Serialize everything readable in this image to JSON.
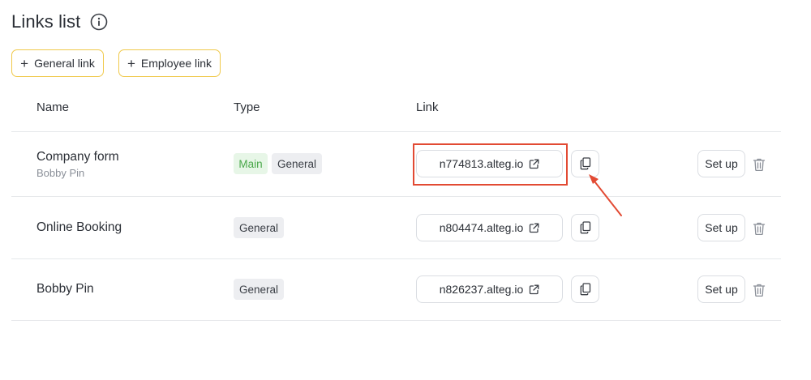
{
  "page": {
    "title": "Links list"
  },
  "actions": {
    "general_link": "General link",
    "employee_link": "Employee link"
  },
  "table": {
    "columns": [
      "Name",
      "Type",
      "Link"
    ],
    "rows": [
      {
        "name": "Company form",
        "subtitle": "Bobby Pin",
        "badges": [
          "Main",
          "General"
        ],
        "link": "n774813.alteg.io",
        "setup": "Set up"
      },
      {
        "name": "Online Booking",
        "subtitle": "",
        "badges": [
          "General"
        ],
        "link": "n804474.alteg.io",
        "setup": "Set up"
      },
      {
        "name": "Bobby Pin",
        "subtitle": "",
        "badges": [
          "General"
        ],
        "link": "n826237.alteg.io",
        "setup": "Set up"
      }
    ]
  },
  "icons": {
    "info": "info-icon",
    "plus": "plus-icon",
    "external_link": "external-link-icon",
    "copy": "copy-icon",
    "trash": "trash-icon"
  },
  "colors": {
    "accent_border": "#f0c94a",
    "main_badge_bg": "#e7f6e7",
    "main_badge_text": "#4aa84a",
    "general_badge_bg": "#edeef1",
    "annotation": "#e24a33"
  }
}
